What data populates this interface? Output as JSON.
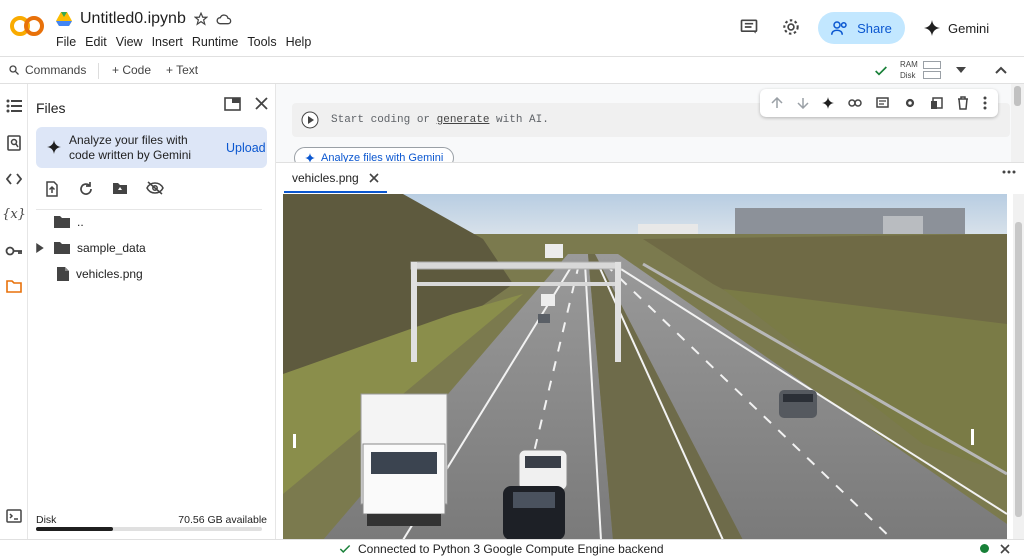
{
  "app": {
    "logo": "CO",
    "notebook_title": "Untitled0.ipynb",
    "menu": [
      "File",
      "Edit",
      "View",
      "Insert",
      "Runtime",
      "Tools",
      "Help"
    ],
    "share_label": "Share",
    "gemini_label": "Gemini",
    "brand_color": "#f9ab00",
    "accent_color": "#0b57d0"
  },
  "toolbar": {
    "commands_label": "Commands",
    "code_label": "+ Code",
    "text_label": "+ Text",
    "ram_label": "RAM",
    "disk_label": "Disk"
  },
  "rail": {
    "icons": [
      "table-of-contents-icon",
      "find-replace-icon",
      "code-snippets-icon",
      "variables-icon",
      "secrets-key-icon",
      "folder-icon",
      "terminal-icon"
    ]
  },
  "files_panel": {
    "title": "Files",
    "promo_text": "Analyze your files with code written by Gemini",
    "upload_label": "Upload",
    "tree": [
      {
        "name": "..",
        "type": "folder-up"
      },
      {
        "name": "sample_data",
        "type": "folder"
      },
      {
        "name": "vehicles.png",
        "type": "file"
      }
    ],
    "disk_label": "Disk",
    "disk_available": "70.56 GB available",
    "disk_used_fraction": 0.34
  },
  "cell": {
    "placeholder_start": "Start coding or ",
    "placeholder_link": "generate",
    "placeholder_end": " with AI.",
    "analyze_chip": "Analyze files with Gemini"
  },
  "viewer": {
    "tab_label": "vehicles.png"
  },
  "status": {
    "text": "Connected to Python 3 Google Compute Engine backend",
    "ok_color": "#188038"
  }
}
